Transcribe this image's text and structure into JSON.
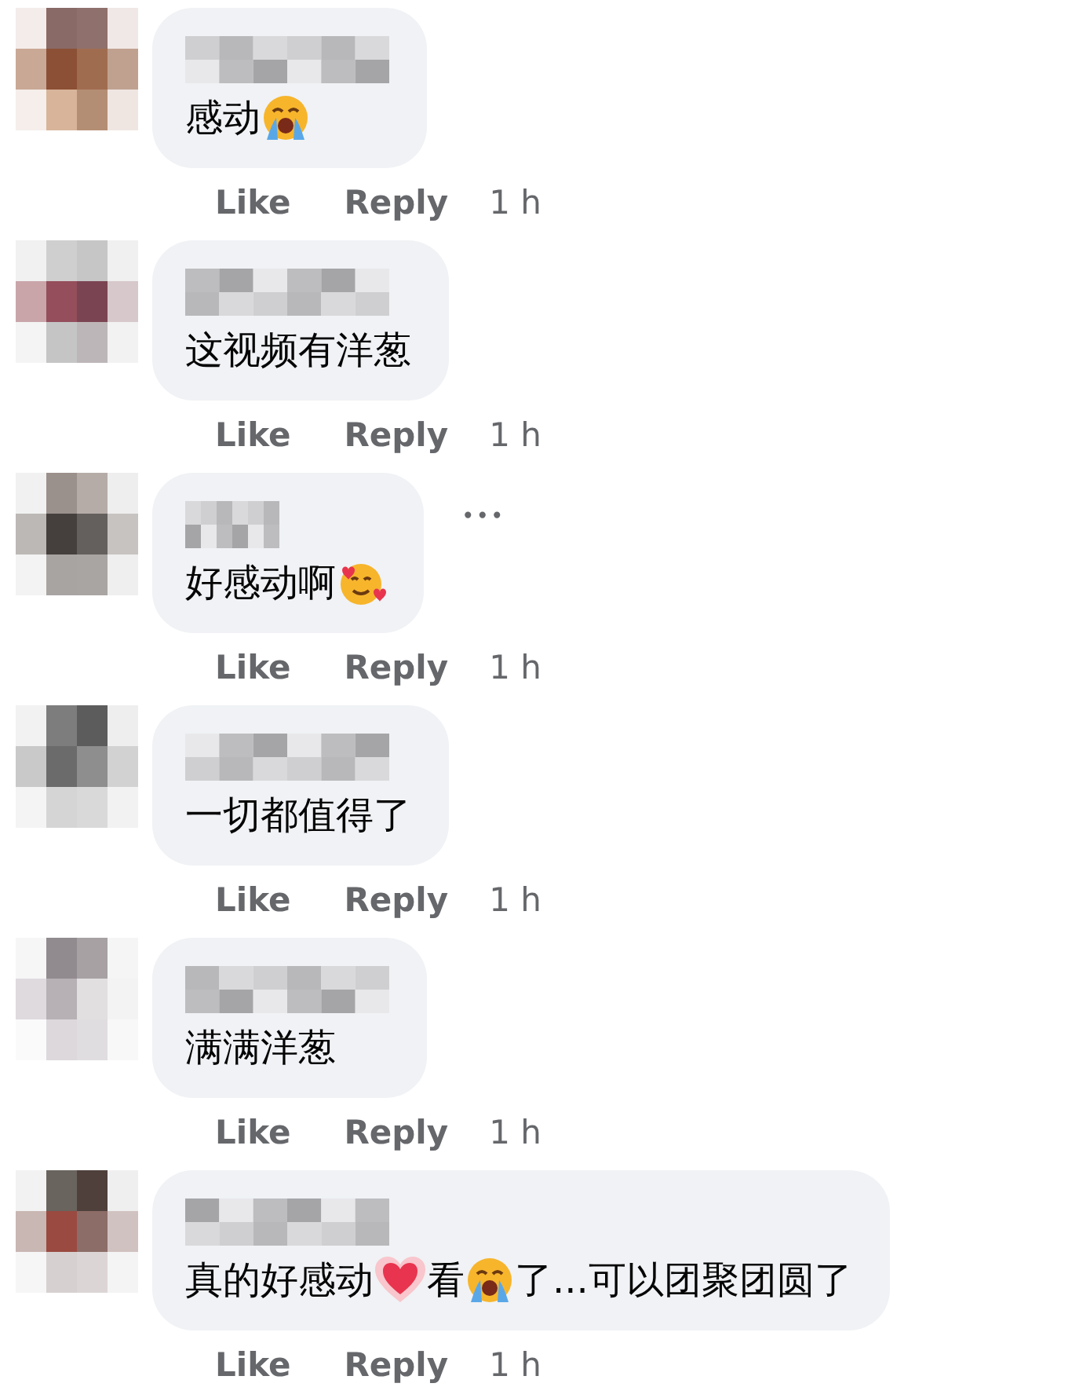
{
  "comments": [
    {
      "body": [
        {
          "kind": "text",
          "text": "感动"
        },
        {
          "kind": "sob"
        }
      ],
      "actions": {
        "like": "Like",
        "reply": "Reply",
        "time": "1 h"
      }
    },
    {
      "body": [
        {
          "kind": "text",
          "text": "这视频有洋葱"
        }
      ],
      "actions": {
        "like": "Like",
        "reply": "Reply",
        "time": "1 h"
      }
    },
    {
      "body": [
        {
          "kind": "text",
          "text": "好感动啊"
        },
        {
          "kind": "hearts"
        }
      ],
      "more": "•••",
      "actions": {
        "like": "Like",
        "reply": "Reply",
        "time": "1 h"
      }
    },
    {
      "body": [
        {
          "kind": "text",
          "text": "一切都值得了"
        }
      ],
      "actions": {
        "like": "Like",
        "reply": "Reply",
        "time": "1 h"
      }
    },
    {
      "body": [
        {
          "kind": "text",
          "text": "满满洋葱"
        }
      ],
      "actions": {
        "like": "Like",
        "reply": "Reply",
        "time": "1 h"
      }
    },
    {
      "body": [
        {
          "kind": "text",
          "text": "真的好感动"
        },
        {
          "kind": "heart"
        },
        {
          "kind": "text",
          "text": "看"
        },
        {
          "kind": "sob"
        },
        {
          "kind": "text",
          "text": "了...可以团聚团圆了"
        }
      ],
      "actions": {
        "like": "Like",
        "reply": "Reply",
        "time": "1 h"
      }
    }
  ]
}
